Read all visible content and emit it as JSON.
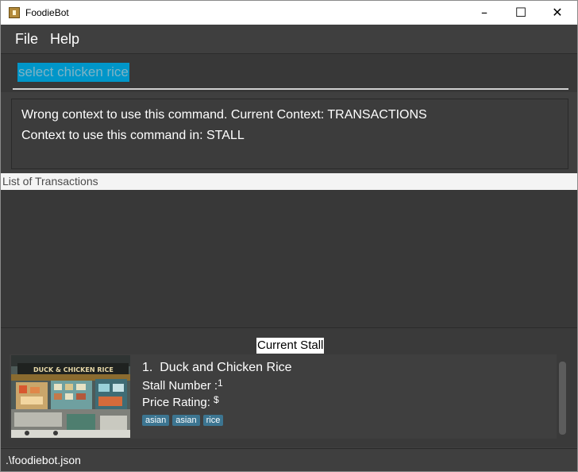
{
  "window": {
    "title": "FoodieBot",
    "controls": {
      "minimize": "–",
      "maximize": "☐",
      "close": "✕"
    }
  },
  "menu": {
    "items": [
      "File",
      "Help"
    ]
  },
  "command_box": {
    "value": "select chicken rice",
    "selected": true
  },
  "result_display": {
    "lines": [
      "Wrong context to use this command. Current Context: TRANSACTIONS",
      "Context to use this command in: STALL"
    ]
  },
  "transactions_panel": {
    "header": "List of Transactions",
    "items": []
  },
  "current_stall": {
    "label": "Current Stall",
    "index": "1.",
    "name": "Duck and Chicken Rice",
    "stall_number_label": "Stall Number :",
    "stall_number": "1",
    "price_rating_label": "Price Rating:",
    "price_rating": "$",
    "tags": [
      "asian",
      "asian",
      "rice"
    ],
    "image_sign_text": "DUCK & CHICKEN RICE"
  },
  "status_bar": {
    "path": ".\\foodiebot.json"
  },
  "colors": {
    "background": "#3f3f3f",
    "selection": "#0096c9",
    "tag": "#3c7591",
    "header_bg": "#f4f4f4"
  }
}
